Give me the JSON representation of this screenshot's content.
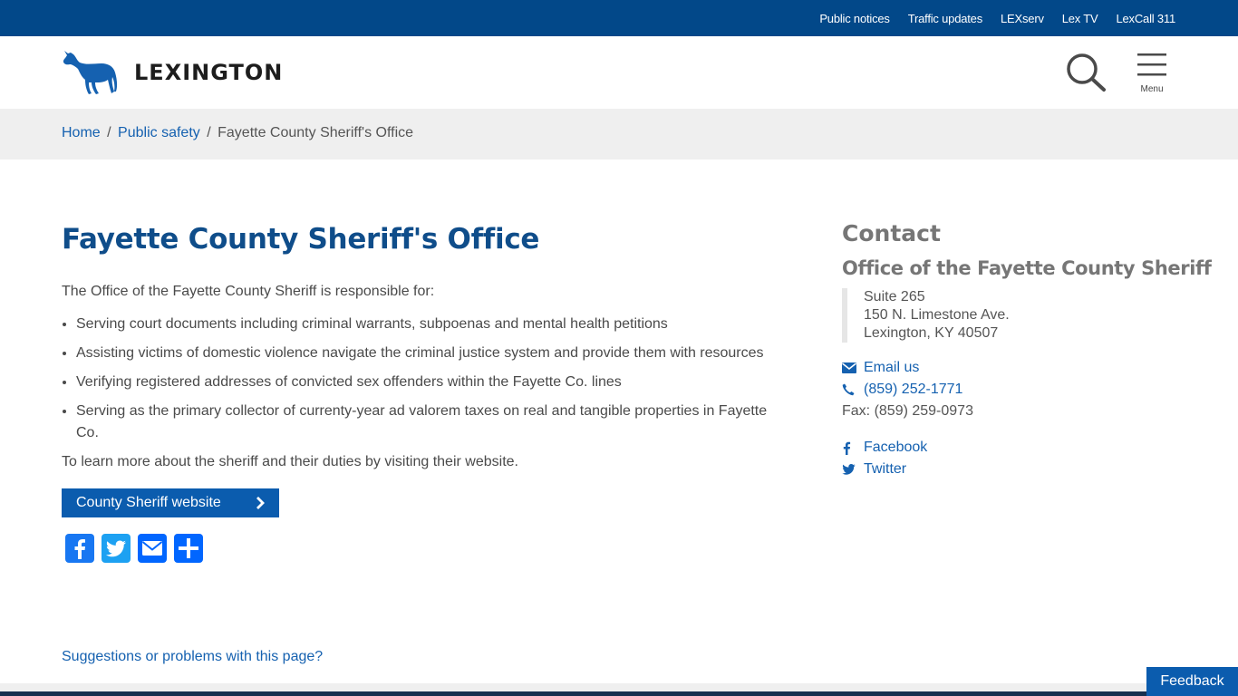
{
  "utility_links": [
    "Public notices",
    "Traffic updates",
    "LEXserv",
    "Lex TV",
    "LexCall 311"
  ],
  "header": {
    "logo_text": "LEXINGTON",
    "menu_label": "Menu"
  },
  "breadcrumb": {
    "home": "Home",
    "separator": "/",
    "section": "Public safety",
    "current": "Fayette County Sheriff's Office"
  },
  "main": {
    "title": "Fayette County Sheriff's Office",
    "intro": "The Office of the Fayette County Sheriff is responsible for:",
    "duties": [
      "Serving court documents including criminal warrants, subpoenas and mental health petitions",
      "Assisting victims of domestic violence navigate the criminal justice system and provide them with resources",
      "Verifying registered addresses of convicted sex offenders within the Fayette Co. lines",
      "Serving as the primary collector of currenty-year ad valorem taxes on real and tangible properties in Fayette Co."
    ],
    "learn_more": "To learn more about the sheriff and their duties by visiting their website.",
    "cta_label": "County Sheriff website",
    "share_icons": [
      "facebook-icon",
      "twitter-icon",
      "email-icon",
      "share-icon"
    ],
    "suggestions_link": "Suggestions or problems with this page?"
  },
  "contact": {
    "heading": "Contact",
    "org": "Office of the Fayette County Sheriff",
    "address": [
      "Suite 265",
      "150 N. Limestone Ave.",
      "Lexington, KY  40507"
    ],
    "email_label": "Email us",
    "phone": "(859) 252-1771",
    "fax": "Fax: (859) 259-0973",
    "facebook": "Facebook",
    "twitter": "Twitter"
  },
  "feedback_label": "Feedback",
  "colors": {
    "brand_blue": "#024889",
    "link_blue": "#1561b0",
    "title_blue": "#0f4d8a",
    "button_blue": "#0b5cae",
    "facebook": "#3b5998",
    "twitter": "#1da1f2",
    "email": "#0166ff",
    "share": "#0166ff"
  }
}
